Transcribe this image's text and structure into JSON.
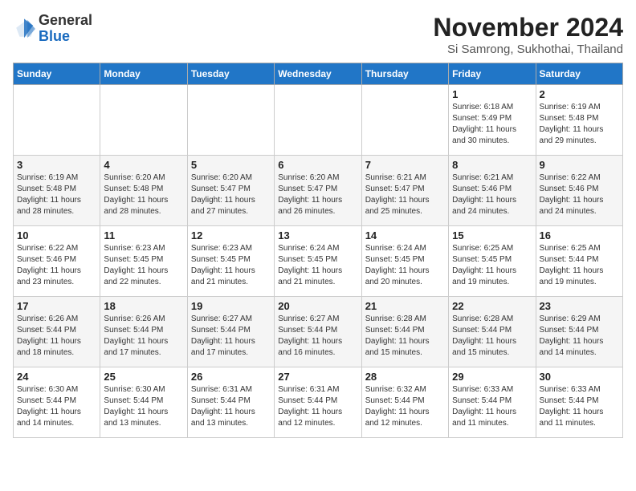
{
  "header": {
    "logo_line1": "General",
    "logo_line2": "Blue",
    "month": "November 2024",
    "location": "Si Samrong, Sukhothai, Thailand"
  },
  "weekdays": [
    "Sunday",
    "Monday",
    "Tuesday",
    "Wednesday",
    "Thursday",
    "Friday",
    "Saturday"
  ],
  "weeks": [
    [
      {
        "day": "",
        "info": ""
      },
      {
        "day": "",
        "info": ""
      },
      {
        "day": "",
        "info": ""
      },
      {
        "day": "",
        "info": ""
      },
      {
        "day": "",
        "info": ""
      },
      {
        "day": "1",
        "info": "Sunrise: 6:18 AM\nSunset: 5:49 PM\nDaylight: 11 hours\nand 30 minutes."
      },
      {
        "day": "2",
        "info": "Sunrise: 6:19 AM\nSunset: 5:48 PM\nDaylight: 11 hours\nand 29 minutes."
      }
    ],
    [
      {
        "day": "3",
        "info": "Sunrise: 6:19 AM\nSunset: 5:48 PM\nDaylight: 11 hours\nand 28 minutes."
      },
      {
        "day": "4",
        "info": "Sunrise: 6:20 AM\nSunset: 5:48 PM\nDaylight: 11 hours\nand 28 minutes."
      },
      {
        "day": "5",
        "info": "Sunrise: 6:20 AM\nSunset: 5:47 PM\nDaylight: 11 hours\nand 27 minutes."
      },
      {
        "day": "6",
        "info": "Sunrise: 6:20 AM\nSunset: 5:47 PM\nDaylight: 11 hours\nand 26 minutes."
      },
      {
        "day": "7",
        "info": "Sunrise: 6:21 AM\nSunset: 5:47 PM\nDaylight: 11 hours\nand 25 minutes."
      },
      {
        "day": "8",
        "info": "Sunrise: 6:21 AM\nSunset: 5:46 PM\nDaylight: 11 hours\nand 24 minutes."
      },
      {
        "day": "9",
        "info": "Sunrise: 6:22 AM\nSunset: 5:46 PM\nDaylight: 11 hours\nand 24 minutes."
      }
    ],
    [
      {
        "day": "10",
        "info": "Sunrise: 6:22 AM\nSunset: 5:46 PM\nDaylight: 11 hours\nand 23 minutes."
      },
      {
        "day": "11",
        "info": "Sunrise: 6:23 AM\nSunset: 5:45 PM\nDaylight: 11 hours\nand 22 minutes."
      },
      {
        "day": "12",
        "info": "Sunrise: 6:23 AM\nSunset: 5:45 PM\nDaylight: 11 hours\nand 21 minutes."
      },
      {
        "day": "13",
        "info": "Sunrise: 6:24 AM\nSunset: 5:45 PM\nDaylight: 11 hours\nand 21 minutes."
      },
      {
        "day": "14",
        "info": "Sunrise: 6:24 AM\nSunset: 5:45 PM\nDaylight: 11 hours\nand 20 minutes."
      },
      {
        "day": "15",
        "info": "Sunrise: 6:25 AM\nSunset: 5:45 PM\nDaylight: 11 hours\nand 19 minutes."
      },
      {
        "day": "16",
        "info": "Sunrise: 6:25 AM\nSunset: 5:44 PM\nDaylight: 11 hours\nand 19 minutes."
      }
    ],
    [
      {
        "day": "17",
        "info": "Sunrise: 6:26 AM\nSunset: 5:44 PM\nDaylight: 11 hours\nand 18 minutes."
      },
      {
        "day": "18",
        "info": "Sunrise: 6:26 AM\nSunset: 5:44 PM\nDaylight: 11 hours\nand 17 minutes."
      },
      {
        "day": "19",
        "info": "Sunrise: 6:27 AM\nSunset: 5:44 PM\nDaylight: 11 hours\nand 17 minutes."
      },
      {
        "day": "20",
        "info": "Sunrise: 6:27 AM\nSunset: 5:44 PM\nDaylight: 11 hours\nand 16 minutes."
      },
      {
        "day": "21",
        "info": "Sunrise: 6:28 AM\nSunset: 5:44 PM\nDaylight: 11 hours\nand 15 minutes."
      },
      {
        "day": "22",
        "info": "Sunrise: 6:28 AM\nSunset: 5:44 PM\nDaylight: 11 hours\nand 15 minutes."
      },
      {
        "day": "23",
        "info": "Sunrise: 6:29 AM\nSunset: 5:44 PM\nDaylight: 11 hours\nand 14 minutes."
      }
    ],
    [
      {
        "day": "24",
        "info": "Sunrise: 6:30 AM\nSunset: 5:44 PM\nDaylight: 11 hours\nand 14 minutes."
      },
      {
        "day": "25",
        "info": "Sunrise: 6:30 AM\nSunset: 5:44 PM\nDaylight: 11 hours\nand 13 minutes."
      },
      {
        "day": "26",
        "info": "Sunrise: 6:31 AM\nSunset: 5:44 PM\nDaylight: 11 hours\nand 13 minutes."
      },
      {
        "day": "27",
        "info": "Sunrise: 6:31 AM\nSunset: 5:44 PM\nDaylight: 11 hours\nand 12 minutes."
      },
      {
        "day": "28",
        "info": "Sunrise: 6:32 AM\nSunset: 5:44 PM\nDaylight: 11 hours\nand 12 minutes."
      },
      {
        "day": "29",
        "info": "Sunrise: 6:33 AM\nSunset: 5:44 PM\nDaylight: 11 hours\nand 11 minutes."
      },
      {
        "day": "30",
        "info": "Sunrise: 6:33 AM\nSunset: 5:44 PM\nDaylight: 11 hours\nand 11 minutes."
      }
    ]
  ]
}
